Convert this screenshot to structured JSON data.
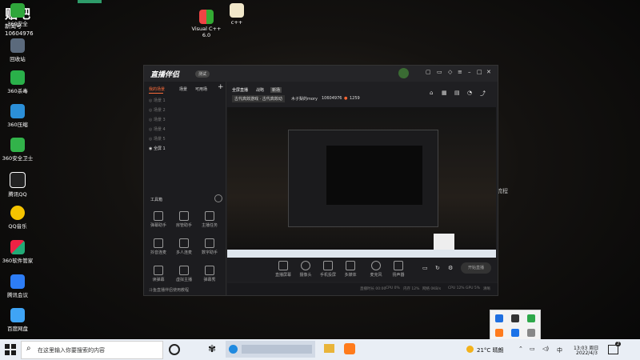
{
  "desktop": {
    "badge_text": "贴吧",
    "badge_sub": "新闻号",
    "badge_id": "10604976",
    "icons": [
      {
        "label": "360安全",
        "name": "360-safe"
      },
      {
        "label": "回收站",
        "name": "recycle-bin"
      },
      {
        "label": "360杀毒",
        "name": "360-antivirus"
      },
      {
        "label": "360压缩",
        "name": "360-zip"
      },
      {
        "label": "360安全卫士",
        "name": "360-guard"
      },
      {
        "label": "腾讯QQ",
        "name": "tencent-qq"
      },
      {
        "label": "QQ音乐",
        "name": "qq-music"
      },
      {
        "label": "360软件管家",
        "name": "360-software"
      },
      {
        "label": "腾讯会议",
        "name": "tencent-meeting"
      },
      {
        "label": "百度网盘",
        "name": "baidu-netdisk"
      }
    ],
    "top_icons": [
      {
        "label": "Visual C++\n6.0",
        "name": "visual-cpp"
      },
      {
        "label": "c++",
        "name": "cpp-file"
      }
    ],
    "side_text": "流程"
  },
  "app": {
    "logo": "直播伴侣",
    "version_badge": "测试",
    "sidebar_tabs": [
      "我的场景",
      "场景",
      "可用场"
    ],
    "scenes": [
      "场景 1",
      "场景 2",
      "场景 3",
      "场景 4",
      "场景 5",
      "全屏 1"
    ],
    "tools_title": "工具箱",
    "tools": [
      "弹幕助手",
      "房管助手",
      "主播任务",
      "抖音连麦",
      "多人连麦",
      "数字助手",
      "读弹幕",
      "虚拟主播",
      "弹幕秀"
    ],
    "sidebar_footer": "斗鱼直播伴侣使用教程",
    "header_tabs": [
      "全屏直播",
      "战略",
      "新场"
    ],
    "room_title": "古代高效游戏 · 古代高效动",
    "room_owner": "木子梨的mory",
    "room_id": "10604976",
    "fire_count": "1259",
    "bottom_buttons": [
      "直播屏幕",
      "摄像头",
      "手机投屏",
      "多媒体",
      "麦克风",
      "扬声器"
    ],
    "start_button": "开始直播",
    "status": [
      "直播时长 00:00",
      "CPU 0%",
      "内存 12%",
      "网络 0KB/s",
      "CPU 12%",
      "GPU 5%",
      "清晰"
    ]
  },
  "taskbar": {
    "search_placeholder": "在这里输入你要搜索的内容",
    "weather": "21°C 晴朗",
    "ime": "中",
    "time": "13:03 周日",
    "date": "2022/4/3",
    "notification_count": "2"
  }
}
